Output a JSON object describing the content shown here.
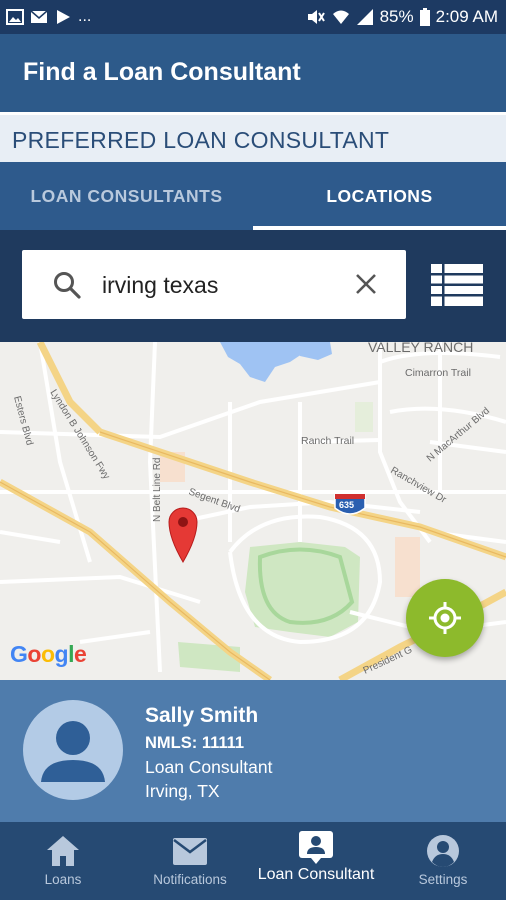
{
  "status_bar": {
    "dots": "...",
    "battery": "85%",
    "time": "2:09 AM"
  },
  "app_bar": {
    "title": "Find a Loan Consultant"
  },
  "preferred": {
    "label": "PREFERRED LOAN CONSULTANT"
  },
  "tabs": [
    {
      "label": "LOAN CONSULTANTS",
      "active": false
    },
    {
      "label": "LOCATIONS",
      "active": true
    }
  ],
  "search": {
    "value": "irving texas",
    "placeholder": ""
  },
  "map": {
    "labels": {
      "valley_ranch": "VALLEY RANCH",
      "cimarron": "Cimarron Trail",
      "ranch_trail": "Ranch Trail",
      "macarthur": "N MacArthur Blvd",
      "ranchview": "Ranchview Dr",
      "lbj": "Lyndon B Johnson Fwy",
      "belt_line": "N Belt Line Rd",
      "segent": "Segent Blvd",
      "esters": "Esters Blvd",
      "president": "President G",
      "highway": "635"
    },
    "google": [
      "G",
      "o",
      "o",
      "g",
      "l",
      "e"
    ],
    "google_colors": [
      "#4285F4",
      "#EA4335",
      "#FBBC05",
      "#4285F4",
      "#34A853",
      "#EA4335"
    ]
  },
  "consultant": {
    "name": "Sally Smith",
    "nmls": "NMLS: 11111",
    "role": "Loan Consultant",
    "location": "Irving, TX"
  },
  "bottom_nav": [
    {
      "label": "Loans",
      "icon": "home-icon",
      "active": false
    },
    {
      "label": "Notifications",
      "icon": "mail-icon",
      "active": false
    },
    {
      "label": "Loan Consultant",
      "icon": "contact-card-icon",
      "active": true
    },
    {
      "label": "Settings",
      "icon": "account-circle-icon",
      "active": false
    }
  ],
  "colors": {
    "primary": "#2d5a8a",
    "dark": "#1f3a5e",
    "locate_button": "#8dba2c",
    "pin": "#e53935"
  }
}
